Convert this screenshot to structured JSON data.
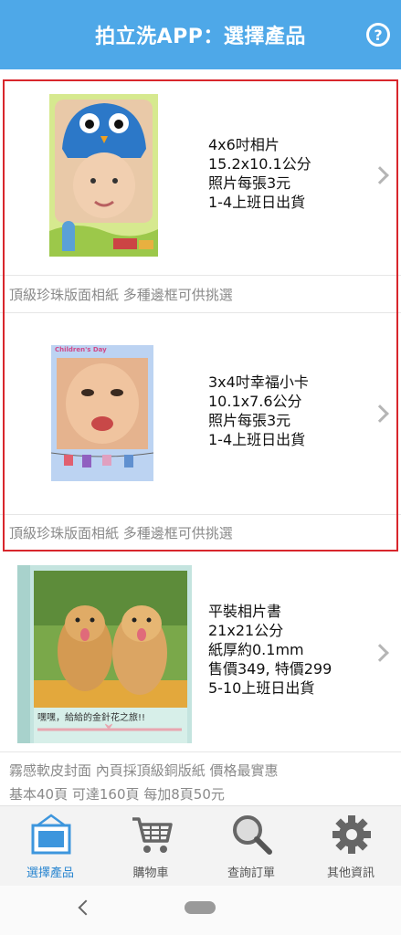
{
  "header": {
    "title": "拍立洗APP：選擇產品",
    "help_icon": "question-circle-icon",
    "color": "#4ea8e8"
  },
  "products": [
    {
      "id": "4x6",
      "lines": [
        "4x6吋相片",
        "15.2x10.1公分",
        "照片每張3元",
        "1-4上班日出貨"
      ],
      "description": [
        "頂級珍珠版面相紙 多種邊框可供挑選"
      ],
      "thumb_text": ""
    },
    {
      "id": "3x4",
      "lines": [
        "3x4吋幸福小卡",
        "10.1x7.6公分",
        "照片每張3元",
        "1-4上班日出貨"
      ],
      "description": [
        "頂級珍珠版面相紙 多種邊框可供挑選"
      ],
      "thumb_text": "Children's Day"
    },
    {
      "id": "book",
      "lines": [
        "平裝相片書",
        "21x21公分",
        "紙厚約0.1mm",
        "售價349, 特價299",
        "5-10上班日出貨"
      ],
      "description": [
        "霧感軟皮封面 內頁採頂級銅版紙 價格最實惠",
        "基本40頁 可達160頁 每加8頁50元"
      ],
      "thumb_text": "嘿嘿，給給的金針花之旅!!"
    }
  ],
  "tabs": [
    {
      "label": "選擇產品",
      "icon": "picture-frame-icon",
      "active": true
    },
    {
      "label": "購物車",
      "icon": "shopping-cart-icon",
      "active": false
    },
    {
      "label": "查詢訂單",
      "icon": "magnifier-icon",
      "active": false
    },
    {
      "label": "其他資訊",
      "icon": "gear-icon",
      "active": false
    }
  ],
  "colors": {
    "accent": "#2a86d0",
    "highlight_border": "#d8262c"
  }
}
